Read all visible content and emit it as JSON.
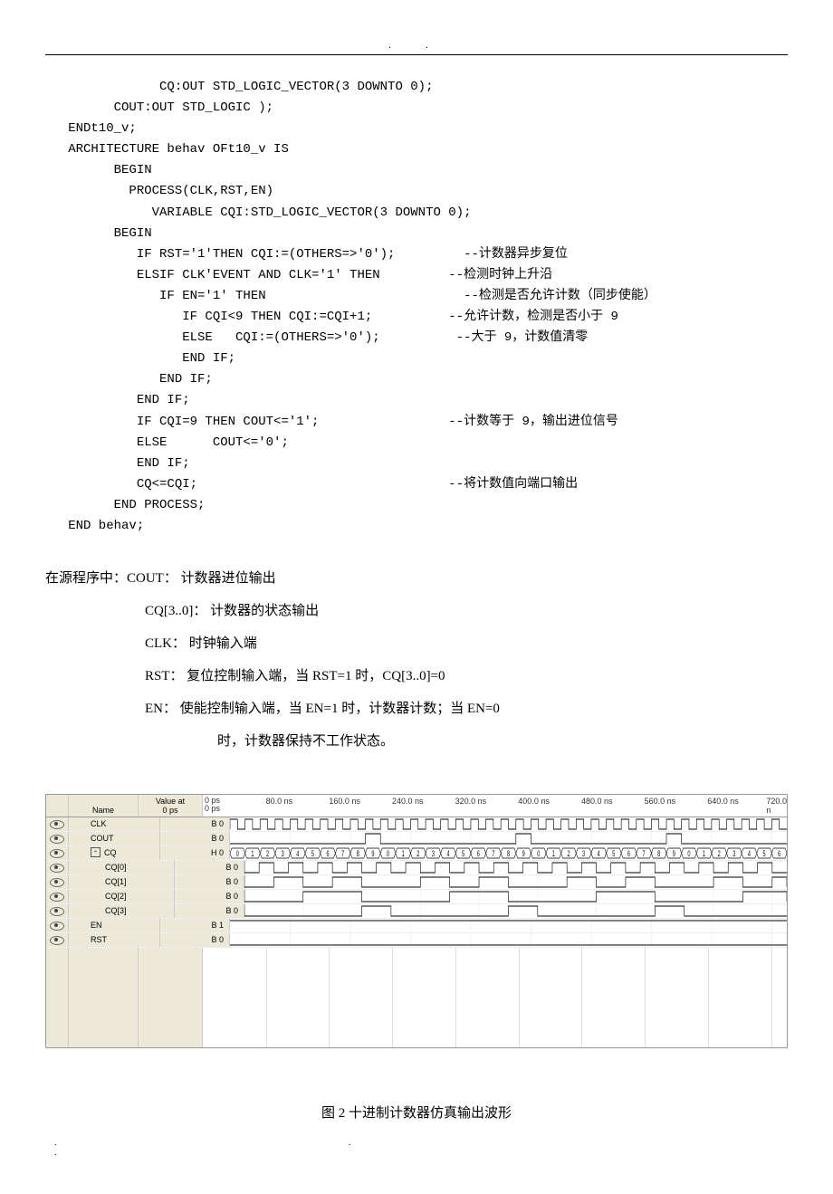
{
  "code_block": "               CQ:OUT STD_LOGIC_VECTOR(3 DOWNTO 0);\n         COUT:OUT STD_LOGIC );\n   ENDt10_v;\n   ARCHITECTURE behav OFt10_v IS\n         BEGIN\n           PROCESS(CLK,RST,EN)\n              VARIABLE CQI:STD_LOGIC_VECTOR(3 DOWNTO 0);\n         BEGIN\n            IF RST='1'THEN CQI:=(OTHERS=>'0');         --计数器异步复位\n            ELSIF CLK'EVENT AND CLK='1' THEN         --检测时钟上升沿\n               IF EN='1' THEN                          --检测是否允许计数（同步使能）\n                  IF CQI<9 THEN CQI:=CQI+1;          --允许计数，检测是否小于 9\n                  ELSE   CQI:=(OTHERS=>'0');          --大于 9，计数值清零\n                  END IF;\n               END IF;\n            END IF;\n            IF CQI=9 THEN COUT<='1';                 --计数等于 9，输出进位信号\n            ELSE      COUT<='0';\n            END IF;\n            CQ<=CQI;                                 --将计数值向端口输出\n         END PROCESS;\n   END behav;",
  "desc": {
    "intro": "在源程序中：COUT：    计数器进位输出",
    "lines": [
      "CQ[3..0]：  计数器的状态输出",
      "CLK：      时钟输入端",
      "RST：      复位控制输入端，当 RST=1 时，CQ[3..0]=0",
      "EN：       使能控制输入端，当 EN=1 时，计数器计数；当 EN=0",
      "    时，计数器保持不工作状态。"
    ]
  },
  "wave": {
    "header_name": "Name",
    "header_val": "Value at\n0 ps",
    "ruler_start": "0 ps\n0 ps",
    "ruler_ticks": [
      "80.0 ns",
      "160.0 ns",
      "240.0 ns",
      "320.0 ns",
      "400.0 ns",
      "480.0 ns",
      "560.0 ns",
      "640.0 ns",
      "720.0 n"
    ],
    "signals": [
      {
        "name": "CLK",
        "val": "B 0",
        "kind": "clock",
        "child": false
      },
      {
        "name": "COUT",
        "val": "B 0",
        "kind": "cout",
        "child": false
      },
      {
        "name": "CQ",
        "val": "H 0",
        "kind": "bus",
        "child": false,
        "toggle": true
      },
      {
        "name": "CQ[0]",
        "val": "B 0",
        "kind": "cq0",
        "child": true
      },
      {
        "name": "CQ[1]",
        "val": "B 0",
        "kind": "cq1",
        "child": true
      },
      {
        "name": "CQ[2]",
        "val": "B 0",
        "kind": "cq2",
        "child": true
      },
      {
        "name": "CQ[3]",
        "val": "B 0",
        "kind": "cq3",
        "child": true
      },
      {
        "name": "EN",
        "val": "B 1",
        "kind": "high",
        "child": false
      },
      {
        "name": "RST",
        "val": "B 0",
        "kind": "low",
        "child": false
      }
    ]
  },
  "chart_data": {
    "type": "table",
    "title": "十进制计数器仿真输出波形",
    "time_unit": "ns",
    "clock_period_ns": 20,
    "visible_range_ns": [
      0,
      740
    ],
    "ruler_ticks_ns": [
      0,
      80,
      160,
      240,
      320,
      400,
      480,
      560,
      640,
      720
    ],
    "inputs": {
      "CLK": "periodic, 20 ns period, starts 0",
      "EN": 1,
      "RST": 0
    },
    "CQ_sequence_per_clock": [
      0,
      1,
      2,
      3,
      4,
      5,
      6,
      7,
      8,
      9,
      0,
      1,
      2,
      3,
      4,
      5,
      6,
      7,
      8,
      9,
      0,
      1,
      2,
      3,
      4,
      5,
      6,
      7,
      8,
      9,
      0,
      1,
      2,
      3,
      4,
      5,
      6
    ],
    "COUT_high_when_CQ_equals": 9,
    "bits": {
      "CQ[0]": "bit0 of CQ (LSB)",
      "CQ[1]": "bit1 of CQ",
      "CQ[2]": "bit2 of CQ",
      "CQ[3]": "bit3 of CQ (MSB)"
    }
  },
  "caption": "图 2 十进制计数器仿真输出波形"
}
